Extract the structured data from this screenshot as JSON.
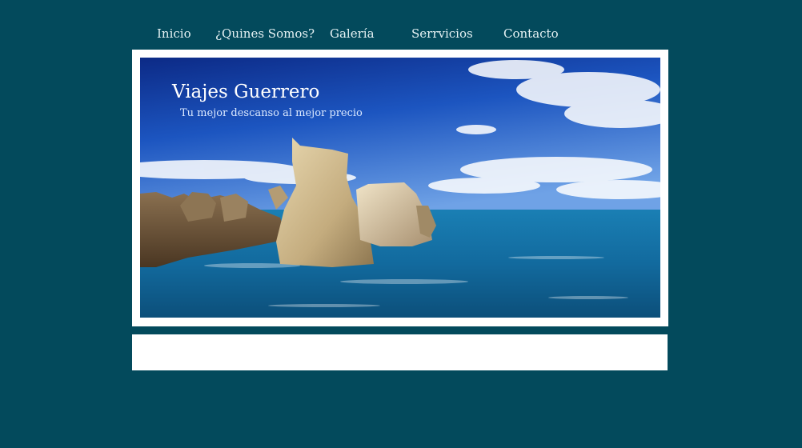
{
  "nav": {
    "items": [
      {
        "label": "Inicio"
      },
      {
        "label": "¿Quines Somos?"
      },
      {
        "label": "Galería"
      },
      {
        "label": "Serrvicios"
      },
      {
        "label": "Contacto"
      }
    ]
  },
  "header": {
    "title": "Viajes Guerrero",
    "tagline": "Tu mejor descanso al mejor precio"
  },
  "colors": {
    "page_background": "#034a5c",
    "frame": "#ffffff",
    "nav_text": "#e6f2f4"
  }
}
